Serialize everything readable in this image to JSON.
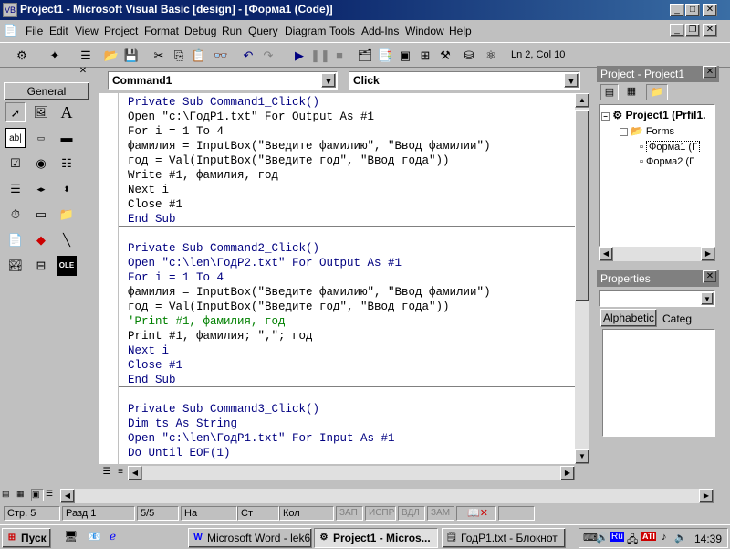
{
  "window": {
    "title": "Project1 - Microsoft Visual Basic [design] - [Форма1 (Code)]"
  },
  "menu": [
    "File",
    "Edit",
    "View",
    "Project",
    "Format",
    "Debug",
    "Run",
    "Query",
    "Diagram",
    "Tools",
    "Add-Ins",
    "Window",
    "Help"
  ],
  "toolbar": {
    "position": "Ln 2, Col 10"
  },
  "toolbox": {
    "tab": "General"
  },
  "code": {
    "object_combo": "Command1",
    "proc_combo": "Click",
    "blocks": [
      [
        "Private Sub Command1_Click()",
        "Open \"c:\\ГодР1.txt\" For Output As #1",
        "For i = 1 To 4",
        "фамилия = InputBox(\"Введите фамилию\", \"Ввод фамилии\")",
        "год = Val(InputBox(\"Введите год\", \"Ввод года\"))",
        "Write #1, фамилия, год",
        "Next i",
        "Close #1",
        "End Sub"
      ],
      [
        "Private Sub Command2_Click()",
        "Open \"c:\\len\\ГодР2.txt\" For Output As #1",
        "For i = 1 To 4",
        "фамилия = InputBox(\"Введите фамилию\", \"Ввод фамилии\")",
        "год = Val(InputBox(\"Введите год\", \"Ввод года\"))",
        "'Print #1, фамилия, год",
        "Print #1, фамилия; \",\"; год",
        "Next i",
        "Close #1",
        "End Sub"
      ],
      [
        "Private Sub Command3_Click()",
        "Dim ts As String",
        "Open \"c:\\len\\ГодР1.txt\" For Input As #1",
        "Do Until EOF(1)"
      ]
    ]
  },
  "project": {
    "title": "Project - Project1",
    "root": "Project1 (Prfil1.",
    "folder": "Forms",
    "items": [
      "Форма1 (Г",
      "Форма2 (Г"
    ]
  },
  "properties": {
    "title": "Properties",
    "tabs": [
      "Alphabetic",
      "Categ"
    ]
  },
  "status": {
    "page": "Стр. 5",
    "section": "Разд 1",
    "pages": "5/5",
    "at": "На",
    "line": "Ст",
    "col": "Кол",
    "rec": "ЗАП",
    "trk": "ИСПР",
    "ext": "ВДЛ",
    "ovr": "ЗАМ"
  },
  "taskbar": {
    "start": "Пуск",
    "tasks": [
      "Microsoft Word - lek6...",
      "Project1 - Micros...",
      "ГодР1.txt - Блокнот"
    ],
    "lang": "Ru",
    "clock": "14:39"
  }
}
